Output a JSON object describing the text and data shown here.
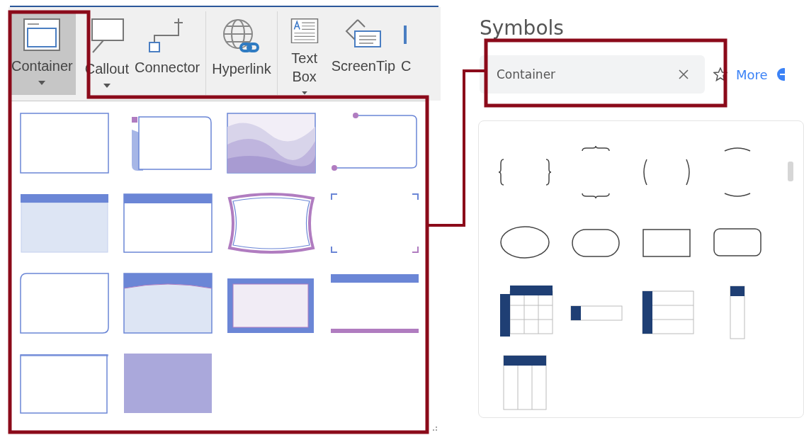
{
  "ribbon": {
    "buttons": [
      {
        "kind": "container",
        "label": "Container",
        "selected": true,
        "dropdown": true
      },
      {
        "kind": "callout",
        "label": "Callout",
        "selected": false,
        "dropdown": true
      },
      {
        "kind": "connector",
        "label": "Connector",
        "selected": false,
        "dropdown": false
      },
      {
        "kind": "hyperlink",
        "label": "Hyperlink",
        "selected": false,
        "dropdown": false
      },
      {
        "kind": "textbox",
        "label": "Text Box",
        "selected": false,
        "dropdown": true
      },
      {
        "kind": "screentip",
        "label": "ScreenTip",
        "selected": false,
        "dropdown": false
      },
      {
        "kind": "partial",
        "label": "C",
        "selected": false,
        "dropdown": false
      }
    ]
  },
  "gallery": {
    "items": [
      {
        "kind": "plain"
      },
      {
        "kind": "tabbed"
      },
      {
        "kind": "wave"
      },
      {
        "kind": "pinned"
      },
      {
        "kind": "headerfill"
      },
      {
        "kind": "header"
      },
      {
        "kind": "curved"
      },
      {
        "kind": "corners"
      },
      {
        "kind": "rounded"
      },
      {
        "kind": "archeader"
      },
      {
        "kind": "framed"
      },
      {
        "kind": "bars"
      },
      {
        "kind": "topline"
      },
      {
        "kind": "shaded"
      }
    ]
  },
  "symbols": {
    "title": "Symbols",
    "search": {
      "value": "Container"
    },
    "more_link": "More",
    "items": [
      {
        "kind": "braces"
      },
      {
        "kind": "hbraces"
      },
      {
        "kind": "parens"
      },
      {
        "kind": "harcs"
      },
      {
        "kind": "ellipse"
      },
      {
        "kind": "stadium"
      },
      {
        "kind": "rectangle"
      },
      {
        "kind": "roundrect"
      },
      {
        "kind": "grid"
      },
      {
        "kind": "rowbar"
      },
      {
        "kind": "rowheaders"
      },
      {
        "kind": "column"
      },
      {
        "kind": "columns"
      }
    ]
  }
}
